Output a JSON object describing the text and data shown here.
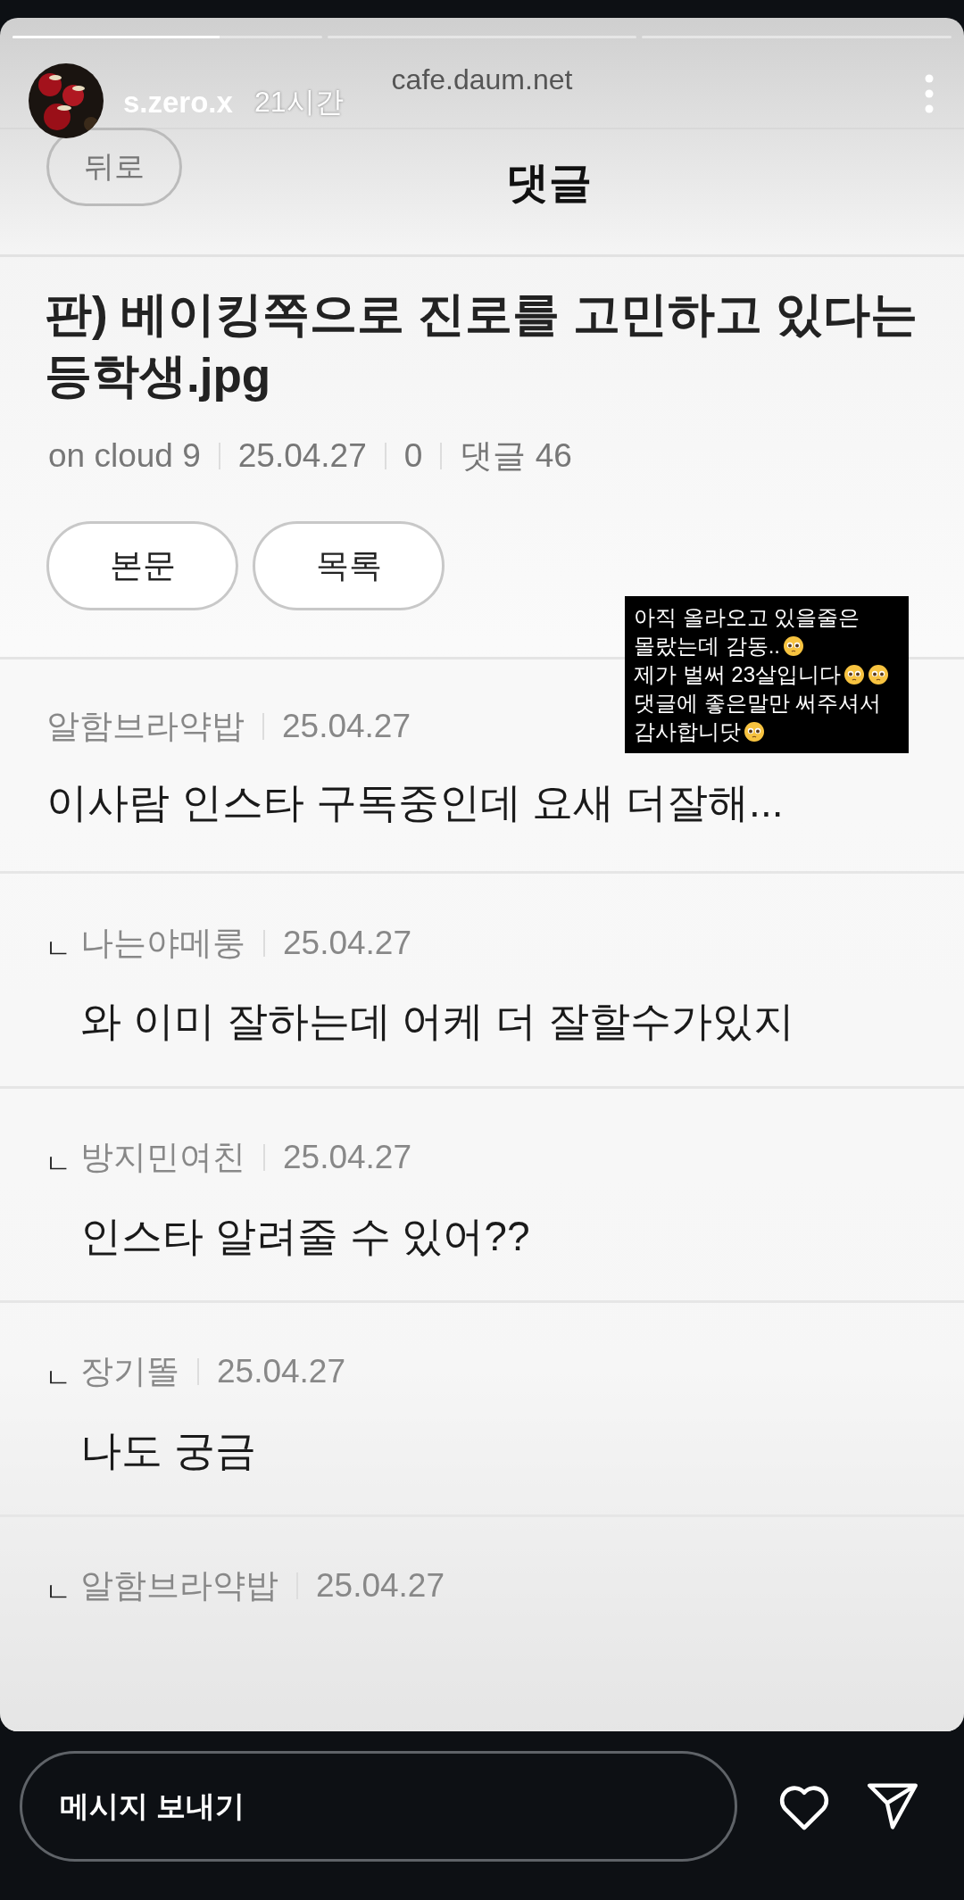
{
  "story": {
    "progress": [
      {
        "selected": true,
        "level": 0.67
      },
      {
        "selected": false
      },
      {
        "selected": false
      }
    ],
    "username": "s.zero.x",
    "time": "21시간",
    "source": "cafe.daum.net"
  },
  "page": {
    "back": "뒤로",
    "heading": "댓글",
    "title": "판) 베이킹쪽으로 진로를 고민하고 있다는",
    "title_line2": "등학생.jpg",
    "meta": [
      "on cloud 9",
      "25.04.27",
      "0",
      "댓글 46"
    ],
    "buttons": [
      "본문",
      "목록"
    ]
  },
  "comments": [
    {
      "kind": "comment",
      "author": "알함브라약밥",
      "date": "25.04.27",
      "text": "이사람 인스타 구독중인데 요새 더잘해..."
    },
    {
      "kind": "reply",
      "mark": "ㄴ",
      "author": "나는야메룽",
      "date": "25.04.27",
      "text": "와 이미 잘하는데 어케 더 잘할수가있지"
    },
    {
      "kind": "reply",
      "mark": "ㄴ",
      "author": "방지민여친",
      "date": "25.04.27",
      "text": "인스타 알려줄 수 있어??"
    },
    {
      "kind": "reply",
      "mark": "ㄴ",
      "author": "장기똘",
      "date": "25.04.27",
      "text": "나도 궁금"
    },
    {
      "kind": "reply",
      "mark": "ㄴ",
      "author": "알함브라약밥",
      "date": "25.04.27"
    }
  ],
  "sticker": {
    "lines": [
      [
        {
          "kind": "text",
          "text": "아직 올라오고 있을줄은"
        }
      ],
      [
        {
          "kind": "text",
          "text": "몰랐는데 감동.."
        },
        {
          "kind": "emoji"
        }
      ],
      [
        {
          "kind": "text",
          "text": "제가 벌써 23살입니다"
        },
        {
          "kind": "emoji"
        },
        {
          "kind": "emoji"
        }
      ],
      [
        {
          "kind": "text",
          "text": "댓글에 좋은말만 써주셔서"
        }
      ],
      [
        {
          "kind": "text",
          "text": "감사합니닷"
        },
        {
          "kind": "emoji"
        }
      ]
    ]
  },
  "reply_bar": {
    "placeholder": "메시지 보내기"
  }
}
